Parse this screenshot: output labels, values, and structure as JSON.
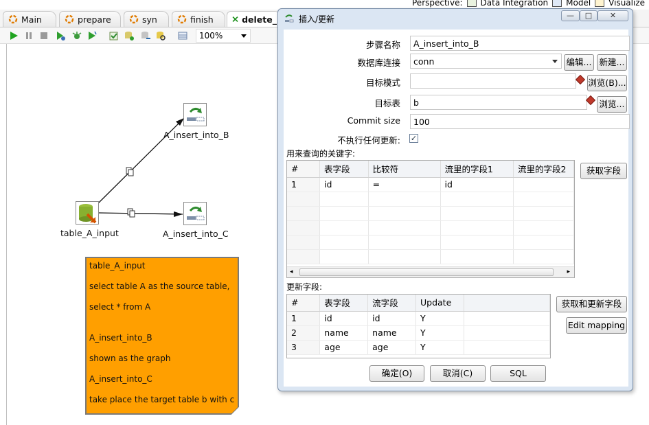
{
  "perspective": {
    "label": "Perspective:",
    "items": [
      "Data Integration",
      "Model",
      "Visualize"
    ]
  },
  "tabs": [
    {
      "label": "Main"
    },
    {
      "label": "prepare"
    },
    {
      "label": "syn"
    },
    {
      "label": "finish"
    },
    {
      "label": "delete_"
    }
  ],
  "toolbar": {
    "zoom": "100%"
  },
  "canvas": {
    "nodes": {
      "source": "table_A_input",
      "target_b": "A_insert_into_B",
      "target_c": "A_insert_into_C"
    },
    "note_lines": [
      "table_A_input",
      "select table A as the source table,",
      "select * from A",
      "A_insert_into_B",
      "shown as the graph",
      "A_insert_into_C",
      "take place the target table b with c"
    ]
  },
  "dialog": {
    "title": "插入/更新",
    "window_buttons": {
      "minimize": "—",
      "maximize": "□",
      "close": "✕"
    },
    "fields": {
      "step_name_label": "步骤名称",
      "step_name_value": "A_insert_into_B",
      "connection_label": "数据库连接",
      "connection_value": "conn",
      "edit_button": "编辑...",
      "new_button": "新建...",
      "schema_label": "目标模式",
      "schema_value": "",
      "browse_schema_button": "浏览(B)...",
      "table_label": "目标表",
      "table_value": "b",
      "browse_table_button": "浏览...",
      "commit_label": "Commit size",
      "commit_value": "100",
      "no_update_label": "不执行任何更新:",
      "no_update_checked": "✓"
    },
    "key_section": {
      "label": "用来查询的关键字:",
      "columns": [
        "#",
        "表字段",
        "比较符",
        "流里的字段1",
        "流里的字段2"
      ],
      "rows": [
        [
          "1",
          "id",
          "=",
          "id",
          ""
        ]
      ],
      "get_fields_button": "获取字段"
    },
    "update_section": {
      "label": "更新字段:",
      "columns": [
        "#",
        "表字段",
        "流字段",
        "Update"
      ],
      "rows": [
        [
          "1",
          "id",
          "id",
          "Y"
        ],
        [
          "2",
          "name",
          "name",
          "Y"
        ],
        [
          "3",
          "age",
          "age",
          "Y"
        ]
      ],
      "get_update_fields_button": "获取和更新字段",
      "edit_mapping_button": "Edit mapping"
    },
    "footer": {
      "ok": "确定(O)",
      "cancel": "取消(C)",
      "sql": "SQL"
    }
  },
  "colors": {
    "note_bg": "#ff9f00",
    "dialog_frame": "#dbe6f3",
    "run_green": "#1fa31f"
  }
}
